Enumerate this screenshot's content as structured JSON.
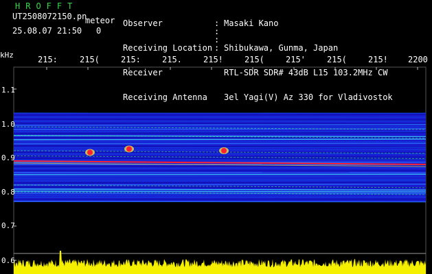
{
  "header": {
    "brand": "HROFFT",
    "filename": "UT2508072150.pn",
    "tag": "meteor",
    "date_time": "25.08.07 21:50",
    "count": "0"
  },
  "info": {
    "keys": [
      "Observer",
      "Receiving Location",
      "Receiver",
      "Receiving Antenna"
    ],
    "values": [
      "Masaki Kano",
      "Shibukawa, Gunma, Japan",
      "RTL-SDR SDR# 43dB L15 103.2MHz CW",
      "3el Yagi(V) Az 330 for Vladivostok"
    ]
  },
  "axes": {
    "y_unit": "kHz",
    "y_ticks": [
      "1.1",
      "1.0",
      "0.9",
      "0.8",
      "0.7",
      "0.6"
    ],
    "x_ticks": [
      "215:",
      "215(",
      "215:",
      "215.",
      "215!",
      "215(",
      "215'",
      "215(",
      "215!",
      "2200"
    ]
  },
  "colors": {
    "background": "#000000",
    "brand": "#38d84a",
    "signal_band": "#1a1ad0",
    "trace": "#ff2030",
    "spectrum": "#f5f000"
  },
  "chart_data": {
    "type": "heatmap",
    "y_unit": "kHz",
    "ylim": [
      0.6,
      1.13
    ],
    "band_khz": [
      0.77,
      1.03
    ],
    "carrier_khz": [
      0.89,
      0.88
    ],
    "meteor_echoes": [
      {
        "x_index": 1.05,
        "y_khz": 0.915
      },
      {
        "x_index": 2.0,
        "y_khz": 0.925
      },
      {
        "x_index": 4.3,
        "y_khz": 0.92
      }
    ]
  }
}
